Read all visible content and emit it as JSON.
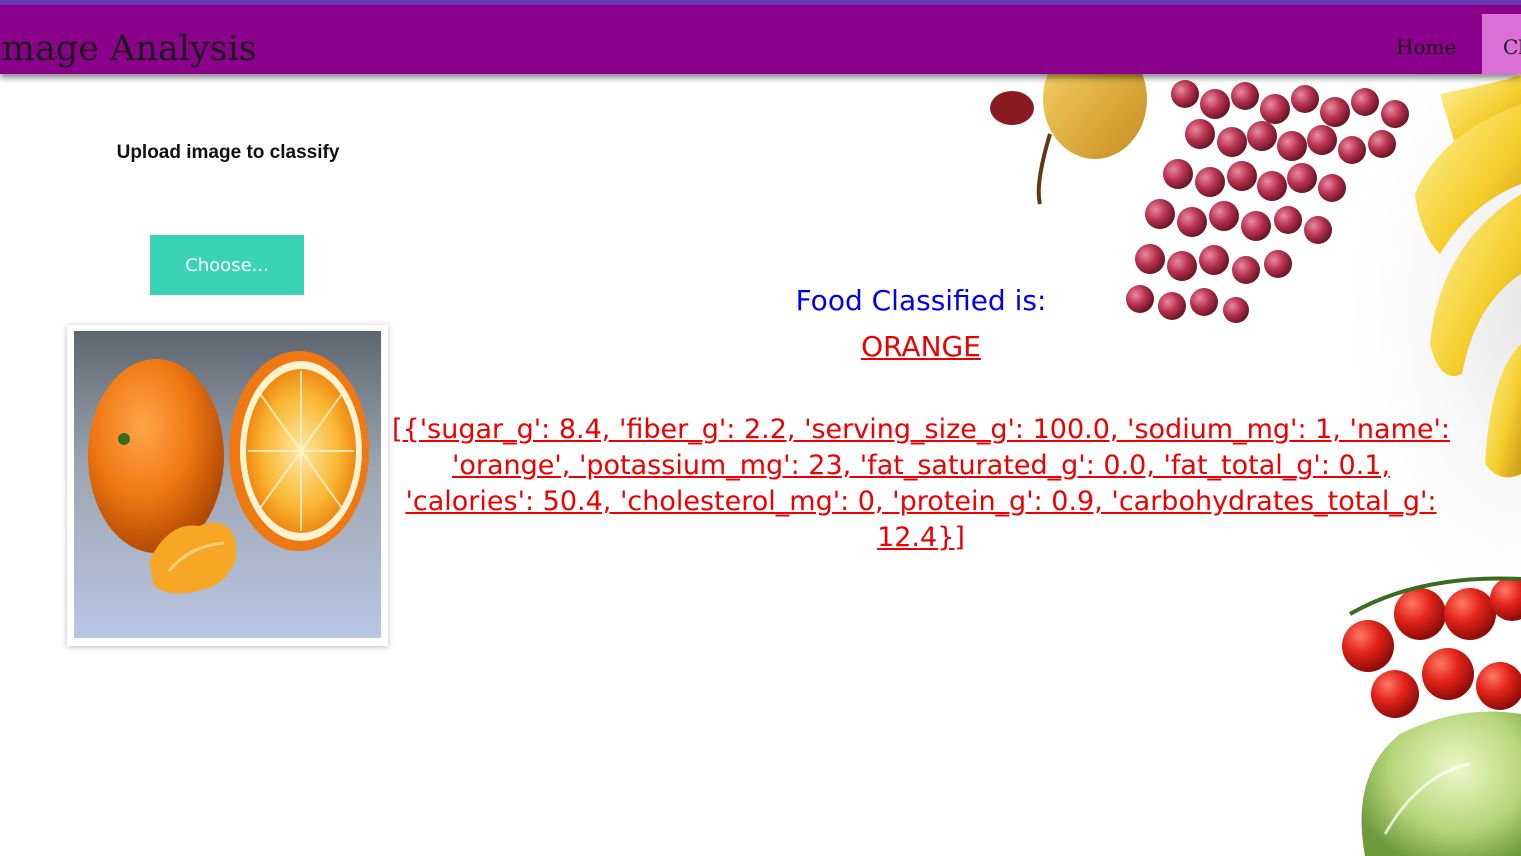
{
  "navbar": {
    "title": "ion Image Analysis",
    "links": [
      {
        "label": "Home"
      },
      {
        "label": "Cl"
      }
    ]
  },
  "upload": {
    "label": "Upload image to classify",
    "button_label": "Choose..."
  },
  "result": {
    "title": "Food Classified is:",
    "food_name": "ORANGE",
    "nutrition_text": "[{'sugar_g': 8.4, 'fiber_g': 2.2, 'serving_size_g': 100.0, 'sodium_mg': 1, 'name': 'orange', 'potassium_mg': 23, 'fat_saturated_g': 0.0, 'fat_total_g': 0.1, 'calories': 50.4, 'cholesterol_mg': 0, 'protein_g': 0.9, 'carbohydrates_total_g': 12.4}]"
  },
  "colors": {
    "navbar": "#8b008b",
    "nav_active": "#da70d6",
    "button": "#3bd3b5",
    "title_blue": "#0000ee",
    "result_red": "#ee0000"
  }
}
